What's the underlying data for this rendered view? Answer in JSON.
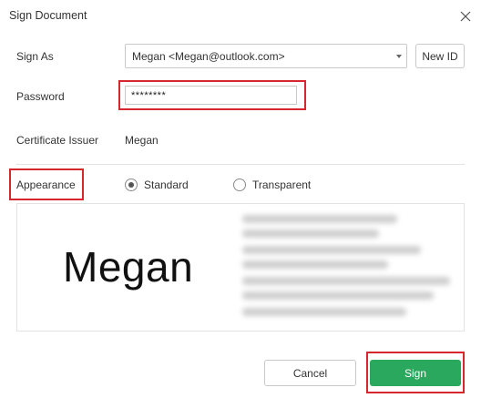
{
  "dialog": {
    "title": "Sign Document"
  },
  "form": {
    "sign_as_label": "Sign As",
    "sign_as_value": "Megan <Megan@outlook.com>",
    "new_id_label": "New ID",
    "password_label": "Password",
    "password_value": "********",
    "certificate_issuer_label": "Certificate Issuer",
    "certificate_issuer_value": "Megan"
  },
  "appearance": {
    "label": "Appearance",
    "options": [
      {
        "label": "Standard",
        "selected": true
      },
      {
        "label": "Transparent",
        "selected": false
      }
    ],
    "preview_name": "Megan"
  },
  "footer": {
    "cancel_label": "Cancel",
    "sign_label": "Sign"
  },
  "colors": {
    "sign_button": "#2aa85e",
    "highlight": "#d6262e"
  },
  "icons": {
    "close": "close-icon",
    "dropdown": "chevron-down-icon"
  }
}
